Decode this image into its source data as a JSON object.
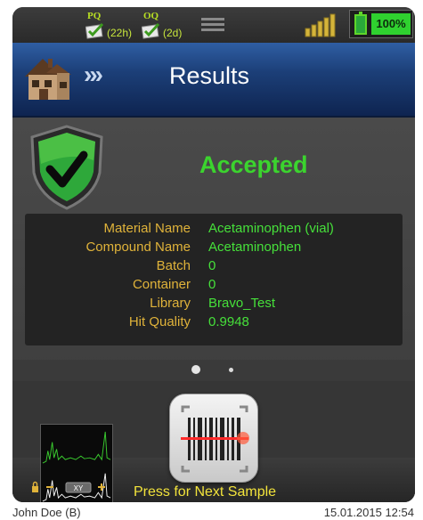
{
  "statusbar": {
    "pq": {
      "label": "PQ",
      "time": "(22h)",
      "icon": "pq-check-icon"
    },
    "oq": {
      "label": "OQ",
      "time": "(2d)",
      "icon": "oq-check-icon"
    },
    "menu_icon": "hamburger-menu-icon",
    "signal_icon": "signal-bars-icon",
    "battery": {
      "percent": "100%",
      "icon": "battery-icon",
      "level": 1.0
    }
  },
  "header": {
    "home_icon": "house-icon",
    "breadcrumb_arrows": "›››",
    "title": "Results"
  },
  "result": {
    "shield_icon": "shield-check-icon",
    "status": "Accepted",
    "status_color": "#3bd42e"
  },
  "details": [
    {
      "key": "Material Name",
      "value": "Acetaminophen (vial)"
    },
    {
      "key": "Compound Name",
      "value": "Acetaminophen"
    },
    {
      "key": "Batch",
      "value": "0"
    },
    {
      "key": "Container",
      "value": "0"
    },
    {
      "key": "Library",
      "value": "Bravo_Test"
    },
    {
      "key": "Hit Quality",
      "value": "0.9948"
    }
  ],
  "pager": {
    "pages": 2,
    "current": 1
  },
  "bottom": {
    "spectrum_icon": "spectrum-thumbnail",
    "scan_icon": "barcode-scan-icon",
    "press_label": "Press for Next Sample",
    "zoom_label": "XY"
  },
  "footer": {
    "user": "John Doe (B)",
    "datetime": "15.01.2015 12:54"
  },
  "colors": {
    "accent_green": "#46e03a",
    "key_gold": "#e0b33a",
    "header_blue": "#1c3f78",
    "press_yellow": "#f2e33b"
  }
}
